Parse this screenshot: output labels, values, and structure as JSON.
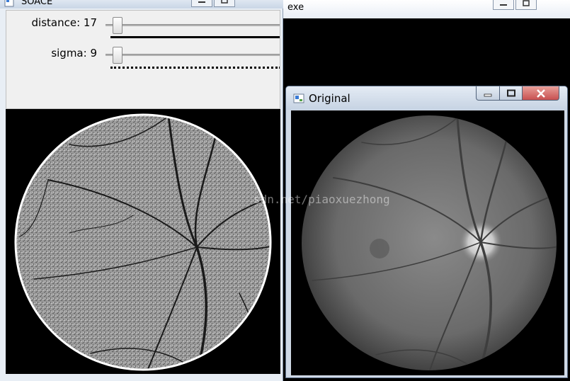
{
  "windows": {
    "soace": {
      "title": "SOACE"
    },
    "exe": {
      "title": "exe"
    },
    "original": {
      "title": "Original"
    }
  },
  "trackbars": [
    {
      "label": "distance: 17",
      "value": 17
    },
    {
      "label": "sigma: 9",
      "value": 9
    }
  ],
  "watermark": "sdn.net/piaoxuezhong",
  "icons": [
    "minimize-icon",
    "maximize-icon",
    "close-icon",
    "app-icon"
  ],
  "colors": {
    "close_button": "#c75050",
    "title_active": "#c6d3e3"
  }
}
